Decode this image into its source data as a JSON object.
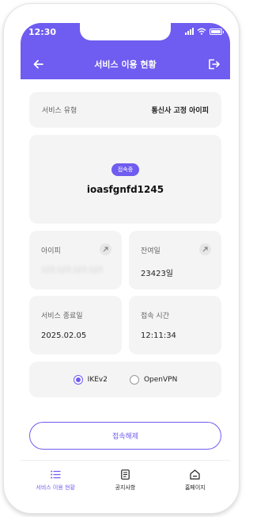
{
  "status_bar": {
    "time": "12:30"
  },
  "header": {
    "title": "서비스 이용 현황"
  },
  "service_type": {
    "label": "서비스 유형",
    "value": "통신사 고정 아이피"
  },
  "connection": {
    "badge": "접속중",
    "user_id": "ioasfgnfd1245"
  },
  "ip_card": {
    "label": "아이피",
    "value": "123.123.123.123"
  },
  "remaining_days": {
    "label": "잔여일",
    "value": "23423일"
  },
  "end_date": {
    "label": "서비스 종료일",
    "value": "2025.02.05"
  },
  "connect_time": {
    "label": "접속 시간",
    "value": "12:11:34"
  },
  "protocols": [
    {
      "label": "IKEv2",
      "checked": true
    },
    {
      "label": "OpenVPN",
      "checked": false
    }
  ],
  "disconnect_button": {
    "label": "접속해제"
  },
  "bottom_nav": [
    {
      "label": "서비스 이용 현황",
      "icon": "list-icon",
      "active": true
    },
    {
      "label": "공지사항",
      "icon": "document-icon",
      "active": false
    },
    {
      "label": "홈페이지",
      "icon": "home-icon",
      "active": false
    }
  ],
  "colors": {
    "accent": "#6f5cf0",
    "card": "#f4f4f4"
  }
}
